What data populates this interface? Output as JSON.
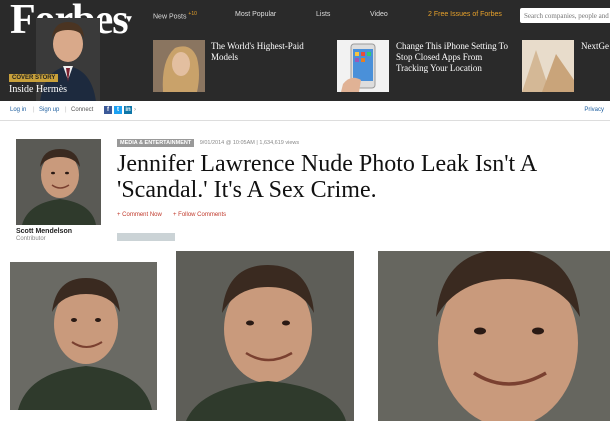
{
  "header": {
    "logo": "Forbes",
    "cover_story_tag": "COVER STORY",
    "cover_story_title": "Inside Hermès",
    "nav": {
      "new_posts": "New Posts",
      "new_posts_badge": "+10",
      "most_popular": "Most Popular",
      "lists": "Lists",
      "video": "Video",
      "free_issues": "2 Free Issues of Forbes"
    },
    "search_placeholder": "Search companies, people and lists",
    "stories": [
      {
        "title": "The World's Highest-Paid Models"
      },
      {
        "title": "Change This iPhone Setting To Stop Closed Apps From Tracking Your Location"
      },
      {
        "title": "NextGe"
      }
    ]
  },
  "subbar": {
    "login": "Log in",
    "signup": "Sign up",
    "connect": "Connect",
    "privacy": "Privacy"
  },
  "author": {
    "name": "Scott Mendelson",
    "role": "Contributor"
  },
  "article": {
    "section": "MEDIA & ENTERTAINMENT",
    "date": "9/01/2014 @ 10:05AM",
    "views": "1,634,619 views",
    "headline": "Jennifer Lawrence Nude Photo Leak Isn't A 'Scandal.' It's A Sex Crime.",
    "comment_now": "+ Comment Now",
    "follow_comments": "+ Follow Comments"
  },
  "colors": {
    "header_bg": "#2a2a2a",
    "accent_orange": "#e8a22b",
    "link_blue": "#2060a0",
    "action_red": "#c0392b"
  }
}
